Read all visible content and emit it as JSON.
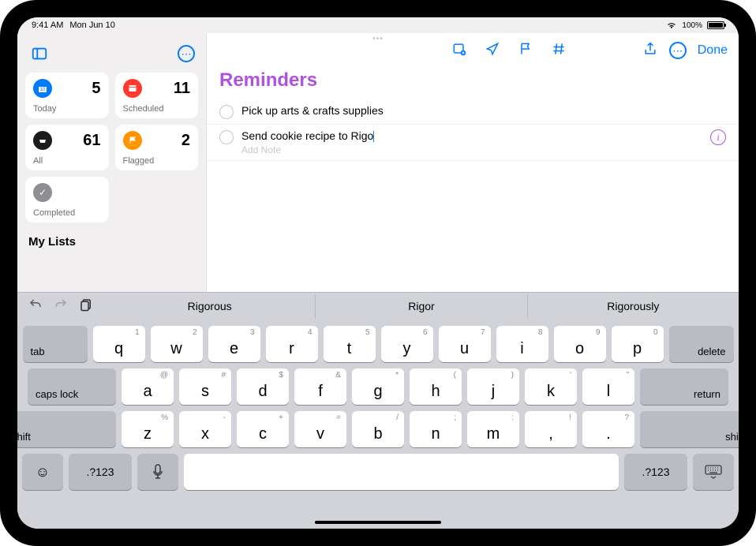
{
  "statusbar": {
    "time": "9:41 AM",
    "date": "Mon Jun 10",
    "battery_percent": "100%"
  },
  "sidebar": {
    "cards": {
      "today": {
        "label": "Today",
        "count": "5"
      },
      "scheduled": {
        "label": "Scheduled",
        "count": "11"
      },
      "all": {
        "label": "All",
        "count": "61"
      },
      "flagged": {
        "label": "Flagged",
        "count": "2"
      },
      "completed": {
        "label": "Completed",
        "count": ""
      }
    },
    "section_title": "My Lists"
  },
  "toolbar": {
    "done_label": "Done"
  },
  "list": {
    "title": "Reminders",
    "items": [
      {
        "text": "Pick up arts & crafts supplies"
      },
      {
        "text": "Send cookie recipe to Rigo"
      }
    ],
    "note_placeholder": "Add Note"
  },
  "keyboard": {
    "suggestions": [
      "Rigorous",
      "Rigor",
      "Rigorously"
    ],
    "row1": [
      {
        "k": "q",
        "a": "1"
      },
      {
        "k": "w",
        "a": "2"
      },
      {
        "k": "e",
        "a": "3"
      },
      {
        "k": "r",
        "a": "4"
      },
      {
        "k": "t",
        "a": "5"
      },
      {
        "k": "y",
        "a": "6"
      },
      {
        "k": "u",
        "a": "7"
      },
      {
        "k": "i",
        "a": "8"
      },
      {
        "k": "o",
        "a": "9"
      },
      {
        "k": "p",
        "a": "0"
      }
    ],
    "row2": [
      {
        "k": "a",
        "a": "@"
      },
      {
        "k": "s",
        "a": "#"
      },
      {
        "k": "d",
        "a": "$"
      },
      {
        "k": "f",
        "a": "&"
      },
      {
        "k": "g",
        "a": "*"
      },
      {
        "k": "h",
        "a": "("
      },
      {
        "k": "j",
        "a": ")"
      },
      {
        "k": "k",
        "a": "'"
      },
      {
        "k": "l",
        "a": "\""
      }
    ],
    "row3": [
      {
        "k": "z",
        "a": "%"
      },
      {
        "k": "x",
        "a": "-"
      },
      {
        "k": "c",
        "a": "+"
      },
      {
        "k": "v",
        "a": "="
      },
      {
        "k": "b",
        "a": "/"
      },
      {
        "k": "n",
        "a": ";"
      },
      {
        "k": "m",
        "a": ":"
      },
      {
        "k": ",",
        "a": "!"
      },
      {
        "k": ".",
        "a": "?"
      }
    ],
    "labels": {
      "tab": "tab",
      "delete": "delete",
      "caps": "caps lock",
      "return": "return",
      "shift": "shift",
      "numbers": ".?123"
    }
  }
}
